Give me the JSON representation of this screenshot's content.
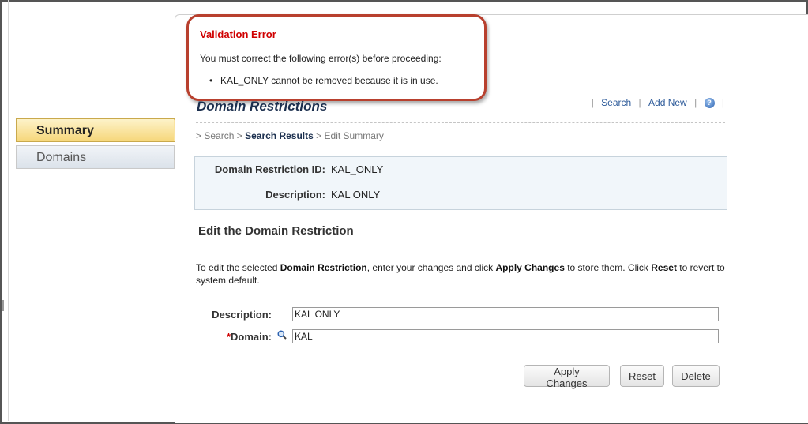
{
  "error": {
    "title": "Validation Error",
    "message": "You must correct the following error(s) before proceeding:",
    "items": [
      "KAL_ONLY cannot be removed because it is in use."
    ]
  },
  "sidebar": {
    "items": [
      {
        "label": "Summary",
        "active": true
      },
      {
        "label": "Domains",
        "active": false
      }
    ]
  },
  "page": {
    "title": "Domain Restrictions",
    "links": {
      "search": "Search",
      "add_new": "Add New",
      "separator": "|"
    },
    "help_icon": "help-icon"
  },
  "breadcrumb": {
    "prefix": ">",
    "search": "Search",
    "sep": ">",
    "search_results": "Search Results",
    "current": "Edit Summary"
  },
  "summary": {
    "id_label": "Domain Restriction ID:",
    "id_value": "KAL_ONLY",
    "desc_label": "Description:",
    "desc_value": "KAL ONLY"
  },
  "edit": {
    "section_title": "Edit the Domain Restriction",
    "instructions": {
      "p1": "To edit the selected ",
      "b1": "Domain Restriction",
      "p2": ", enter your changes and click ",
      "b2": "Apply Changes",
      "p3": " to store them. Click ",
      "b3": "Reset",
      "p4": " to revert to system default."
    },
    "description_label": "Description:",
    "description_value": "KAL ONLY",
    "domain_required": "*",
    "domain_label": "Domain:",
    "domain_value": "KAL"
  },
  "buttons": {
    "apply": "Apply Changes",
    "reset": "Reset",
    "delete": "Delete"
  },
  "colors": {
    "error_red": "#d00000",
    "error_border": "#b8402e",
    "active_nav": "#f6d77a",
    "title_navy": "#1b2f4e",
    "link_blue": "#2e5b9a"
  }
}
